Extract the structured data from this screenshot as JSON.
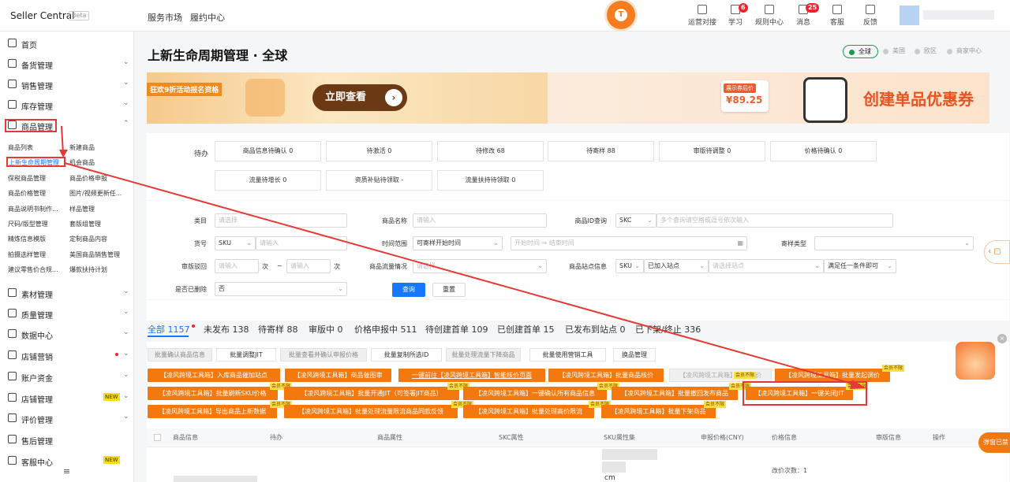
{
  "header": {
    "brand": "Seller Central",
    "beta": "Beta",
    "nav": [
      "服务市场",
      "履约中心"
    ],
    "logo": "T",
    "icons": [
      {
        "label": "运营对接",
        "badge": ""
      },
      {
        "label": "学习",
        "badge": "6"
      },
      {
        "label": "规则中心",
        "badge": ""
      },
      {
        "label": "消息",
        "badge": "25"
      },
      {
        "label": "客服",
        "badge": ""
      },
      {
        "label": "反馈",
        "badge": ""
      }
    ]
  },
  "sidebar": {
    "items": [
      {
        "label": "首页",
        "icon": "home-icon"
      },
      {
        "label": "备货管理",
        "icon": "box-icon"
      },
      {
        "label": "销售管理",
        "icon": "chart-icon"
      },
      {
        "label": "库存管理",
        "icon": "inventory-icon"
      },
      {
        "label": "商品管理",
        "icon": "goods-icon"
      },
      {
        "label": "素材管理",
        "icon": "material-icon"
      },
      {
        "label": "质量管理",
        "icon": "quality-icon"
      },
      {
        "label": "数据中心",
        "icon": "data-icon"
      },
      {
        "label": "店铺营销",
        "icon": "marketing-icon"
      },
      {
        "label": "账户资金",
        "icon": "account-icon"
      },
      {
        "label": "店铺管理",
        "icon": "shop-icon",
        "new": "NEW"
      },
      {
        "label": "评价管理",
        "icon": "review-icon"
      },
      {
        "label": "售后管理",
        "icon": "aftersale-icon"
      },
      {
        "label": "客服中心",
        "icon": "service-icon",
        "new": "NEW"
      }
    ],
    "sub": [
      "商品列表",
      "新建商品",
      "上新生命周期管理",
      "机会商品",
      "保税商品管理",
      "商品价格申报",
      "商品价格管理",
      "图片/视频更新任...",
      "商品说明书制作...",
      "样品管理",
      "尺码/版型管理",
      "套版组管理",
      "精炼信息模版",
      "定制商品内容",
      "拍摄选样管理",
      "美国商品销售管理",
      "建议零售价合规...",
      "爆款扶持计划"
    ]
  },
  "page": {
    "title": "上新生命周期管理 · 全球",
    "regions": [
      "全球",
      "美国",
      "欧区",
      "商家中心"
    ]
  },
  "banner": {
    "left_tag": "狂欢9折活动报名资格",
    "left_btn": "立即查看",
    "card_title": "展示券后价",
    "card_price": "¥89.25",
    "right_text": "创建单品优惠券"
  },
  "todo": {
    "label": "待办",
    "items": [
      "商品信息待确认 0",
      "待激活 0",
      "待修改 68",
      "待寄样 88",
      "审版待调整 0",
      "价格待确认 0",
      "流量待增长 0",
      "资质补贴待领取 -",
      "流量扶持待领取 0"
    ]
  },
  "filters": {
    "category": "类目",
    "category_ph": "请选择",
    "name": "商品名称",
    "name_ph": "请输入",
    "id_query": "商品ID查询",
    "id_type": "SKC",
    "id_ph": "多个查询请空格或逗号依次输入",
    "sku_no": "货号",
    "sku_type": "SKU",
    "sku_ph": "请输入",
    "time_range": "时间范围",
    "time_type": "可寄样开始时间",
    "time_ph": "开始时间 → 结束时间",
    "sample_type": "寄样类型",
    "reject": "审版驳回",
    "reject_ph": "请输入",
    "unit": "次",
    "tilde": "~",
    "traffic": "商品流量情况",
    "traffic_ph": "请选择",
    "site_info": "商品站点信息",
    "site_type": "SKU",
    "site_join": "已加入站点",
    "site_ph": "请选择站点",
    "site_cond": "满足任一条件即可",
    "deleted": "是否已删除",
    "deleted_val": "否",
    "query": "查询",
    "reset": "重置"
  },
  "tabs": [
    "全部 1157",
    "未发布 138",
    "待寄样 88",
    "审版中 0",
    "价格申报中 511",
    "待创建首单 109",
    "已创建首单 15",
    "已发布到站点 0",
    "已下架/终止 336"
  ],
  "bulk": [
    "批量确认商品信息",
    "批量调整JIT",
    "批量查看并确认申报价格",
    "批量复制所选ID",
    "批量处理流量下降商品",
    "批量使用营销工具",
    "换品管理"
  ],
  "tools_row1": [
    "【凌风跨境工具箱】入库商品催加站点",
    "【凌风跨境工具箱】商品催图审",
    "一键前往【凌风跨境工具箱】智能核价页面",
    "【凌风跨境工具箱】批量商品核价",
    "【凌风跨境工具箱】批量调价",
    "【凌风跨境工具箱】批量发起调价"
  ],
  "tools_row2": [
    "【凌风跨境工具箱】批量刷新SKU价格",
    "【凌风跨境工具箱】批量开通JIT（可签署JIT商品）",
    "【凌风跨境工具箱】一键确认所有商品信息",
    "【凌风跨境工具箱】批量撤回发布商品",
    "【凌风跨境工具箱】一键关闭JIT"
  ],
  "tools_row3": [
    "【凌风跨境工具箱】导出商品上新数据",
    "【凌风跨境工具箱】批量处理流量限流商品同款反馈",
    "【凌风跨境工具箱】批量处理高价限流",
    "【凌风跨境工具箱】批量下架商品"
  ],
  "free_tag": "会员不限",
  "table": {
    "headers": [
      "商品信息",
      "待办",
      "商品属性",
      "SKC属性",
      "SKU属性集",
      "申报价格(CNY)",
      "价格信息",
      "审版信息",
      "操作"
    ],
    "cm": "cm",
    "change_count": "改价次数：1"
  },
  "float": {
    "popup": "弹窗已禁"
  },
  "colors": {
    "accent": "#1677ff",
    "orange": "#f3790f",
    "highlight": "#e53935"
  }
}
